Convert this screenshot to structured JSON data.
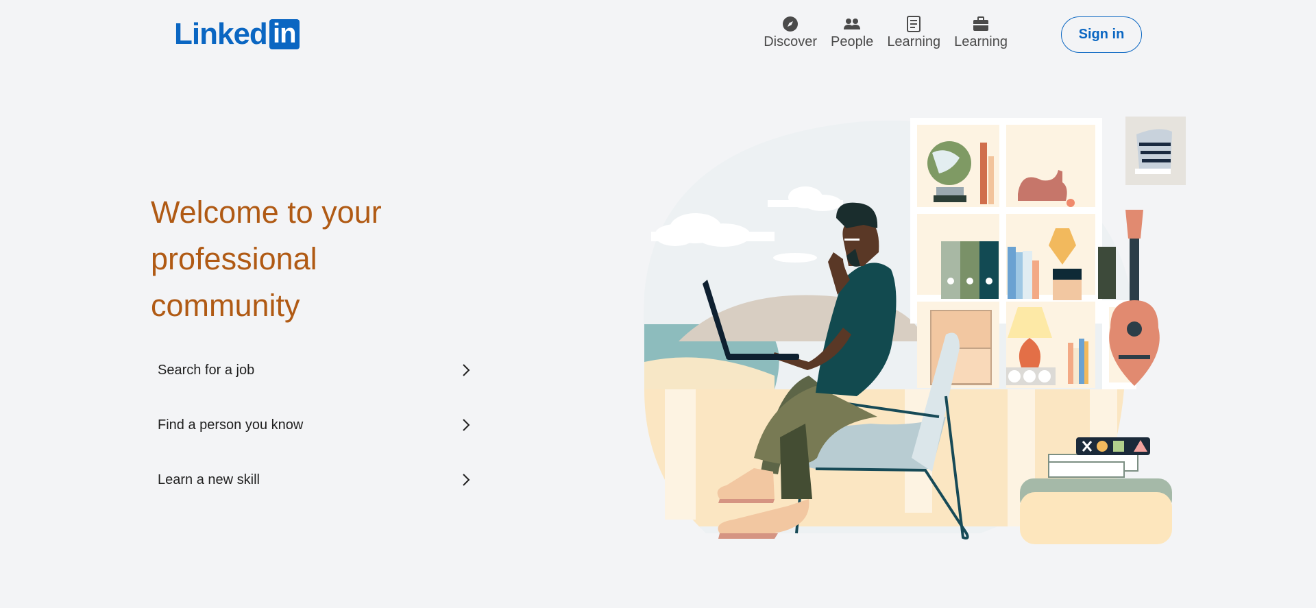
{
  "brand": {
    "word": "Linked",
    "box": "in",
    "color": "#0a66c2"
  },
  "nav": [
    {
      "label": "Discover",
      "icon": "compass-icon"
    },
    {
      "label": "People",
      "icon": "people-icon"
    },
    {
      "label": "Learning",
      "icon": "learning-icon"
    },
    {
      "label": "Learning",
      "icon": "briefcase-icon"
    }
  ],
  "signin": {
    "label": "Sign in"
  },
  "hero": {
    "title": "Welcome to your professional community",
    "title_color": "#b05a14"
  },
  "actions": [
    {
      "label": "Search for a job",
      "icon": "chevron-right-icon"
    },
    {
      "label": "Find a person you know",
      "icon": "chevron-right-icon"
    },
    {
      "label": "Learn a new skill",
      "icon": "chevron-right-icon"
    }
  ]
}
